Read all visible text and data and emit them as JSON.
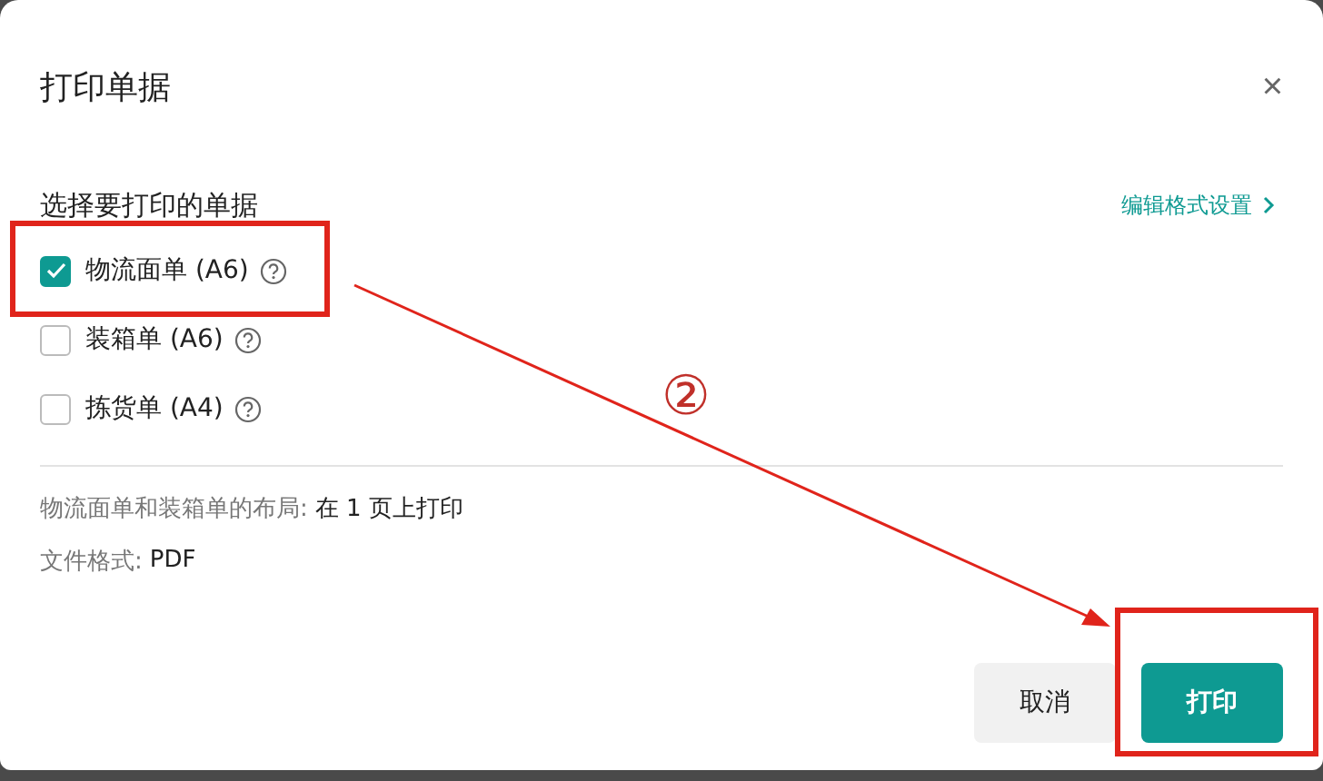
{
  "dialog": {
    "title": "打印单据",
    "close": "×"
  },
  "section": {
    "label": "选择要打印的单据",
    "link": "编辑格式设置"
  },
  "documents": [
    {
      "label": "物流面单 (A6)",
      "checked": true
    },
    {
      "label": "装箱单 (A6)",
      "checked": false
    },
    {
      "label": "拣货单 (A4)",
      "checked": false
    }
  ],
  "info": [
    {
      "label": "物流面单和装箱单的布局:",
      "value": "在 1 页上打印"
    },
    {
      "label": "文件格式:",
      "value": "PDF"
    }
  ],
  "buttons": [
    {
      "label": "取消",
      "kind": "secondary"
    },
    {
      "label": "打印",
      "kind": "primary"
    }
  ],
  "annotation": {
    "step": "②"
  }
}
